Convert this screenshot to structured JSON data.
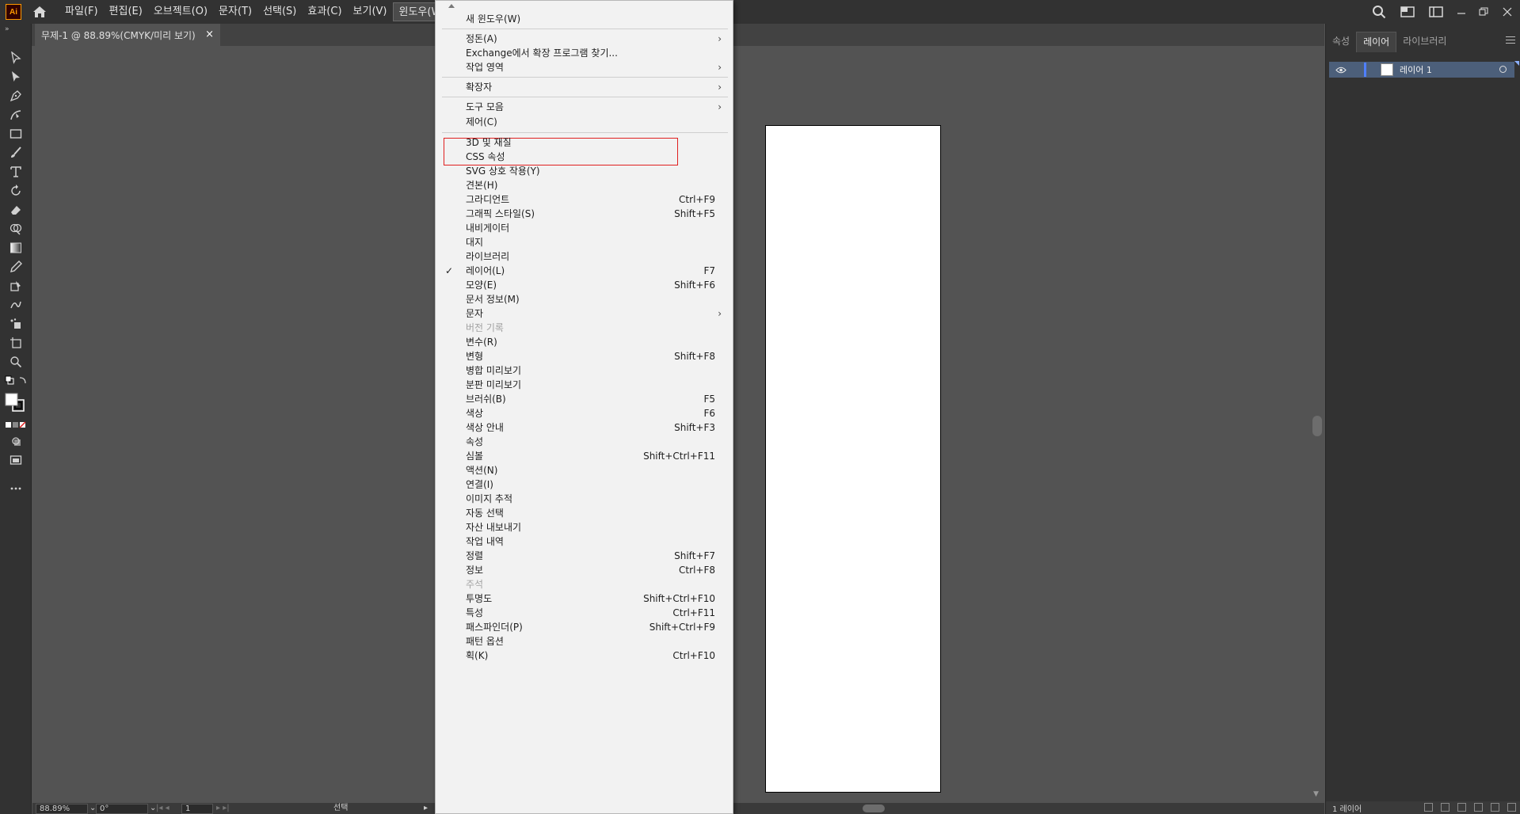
{
  "app": {
    "logo_text": "Ai"
  },
  "menubar": {
    "items": [
      "파일(F)",
      "편집(E)",
      "오브젝트(O)",
      "문자(T)",
      "선택(S)",
      "효과(C)",
      "보기(V)",
      "윈도우(W)"
    ],
    "active_index": 7
  },
  "document_tab": {
    "title": "무제-1 @ 88.89%(CMYK/미리 보기)",
    "close": "×"
  },
  "status": {
    "zoom": "88.89%",
    "rotation": "0°",
    "artboard": "1",
    "tool": "선택"
  },
  "right_panel": {
    "tabs": [
      "속성",
      "레이어",
      "라이브러리"
    ],
    "active_tab": 1,
    "layer_name": "레이어 1",
    "layer_count": "1 레이어"
  },
  "window_menu": {
    "items": [
      {
        "label": "새 윈도우(W)",
        "shortcut": "",
        "submenu": false,
        "checked": false,
        "disabled": false
      },
      {
        "sep": true
      },
      {
        "label": "정돈(A)",
        "shortcut": "",
        "submenu": true,
        "checked": false,
        "disabled": false
      },
      {
        "label": "Exchange에서 확장 프로그램 찾기...",
        "shortcut": "",
        "submenu": false,
        "checked": false,
        "disabled": false
      },
      {
        "label": "작업 영역",
        "shortcut": "",
        "submenu": true,
        "checked": false,
        "disabled": false
      },
      {
        "sep": true
      },
      {
        "label": "확장자",
        "shortcut": "",
        "submenu": true,
        "checked": false,
        "disabled": false
      },
      {
        "sep": true
      },
      {
        "label": "도구 모음",
        "shortcut": "",
        "submenu": true,
        "checked": false,
        "disabled": false
      },
      {
        "label": "제어(C)",
        "shortcut": "",
        "submenu": false,
        "checked": false,
        "disabled": false
      },
      {
        "sep": true
      },
      {
        "label": "3D 및 재질",
        "shortcut": "",
        "submenu": false,
        "checked": false,
        "disabled": false
      },
      {
        "label": "CSS 속성",
        "shortcut": "",
        "submenu": false,
        "checked": false,
        "disabled": false
      },
      {
        "label": "SVG 상호 작용(Y)",
        "shortcut": "",
        "submenu": false,
        "checked": false,
        "disabled": false
      },
      {
        "label": "견본(H)",
        "shortcut": "",
        "submenu": false,
        "checked": false,
        "disabled": false
      },
      {
        "label": "그라디언트",
        "shortcut": "Ctrl+F9",
        "submenu": false,
        "checked": false,
        "disabled": false
      },
      {
        "label": "그래픽 스타일(S)",
        "shortcut": "Shift+F5",
        "submenu": false,
        "checked": false,
        "disabled": false
      },
      {
        "label": "내비게이터",
        "shortcut": "",
        "submenu": false,
        "checked": false,
        "disabled": false
      },
      {
        "label": "대지",
        "shortcut": "",
        "submenu": false,
        "checked": false,
        "disabled": false
      },
      {
        "label": "라이브러리",
        "shortcut": "",
        "submenu": false,
        "checked": false,
        "disabled": false
      },
      {
        "label": "레이어(L)",
        "shortcut": "F7",
        "submenu": false,
        "checked": true,
        "disabled": false
      },
      {
        "label": "모양(E)",
        "shortcut": "Shift+F6",
        "submenu": false,
        "checked": false,
        "disabled": false
      },
      {
        "label": "문서 정보(M)",
        "shortcut": "",
        "submenu": false,
        "checked": false,
        "disabled": false
      },
      {
        "label": "문자",
        "shortcut": "",
        "submenu": true,
        "checked": false,
        "disabled": false
      },
      {
        "label": "버전 기록",
        "shortcut": "",
        "submenu": false,
        "checked": false,
        "disabled": true
      },
      {
        "label": "변수(R)",
        "shortcut": "",
        "submenu": false,
        "checked": false,
        "disabled": false
      },
      {
        "label": "변형",
        "shortcut": "Shift+F8",
        "submenu": false,
        "checked": false,
        "disabled": false
      },
      {
        "label": "병합 미리보기",
        "shortcut": "",
        "submenu": false,
        "checked": false,
        "disabled": false
      },
      {
        "label": "분판 미리보기",
        "shortcut": "",
        "submenu": false,
        "checked": false,
        "disabled": false
      },
      {
        "label": "브러쉬(B)",
        "shortcut": "F5",
        "submenu": false,
        "checked": false,
        "disabled": false
      },
      {
        "label": "색상",
        "shortcut": "F6",
        "submenu": false,
        "checked": false,
        "disabled": false
      },
      {
        "label": "색상 안내",
        "shortcut": "Shift+F3",
        "submenu": false,
        "checked": false,
        "disabled": false
      },
      {
        "label": "속성",
        "shortcut": "",
        "submenu": false,
        "checked": false,
        "disabled": false
      },
      {
        "label": "심볼",
        "shortcut": "Shift+Ctrl+F11",
        "submenu": false,
        "checked": false,
        "disabled": false
      },
      {
        "label": "액션(N)",
        "shortcut": "",
        "submenu": false,
        "checked": false,
        "disabled": false
      },
      {
        "label": "연결(I)",
        "shortcut": "",
        "submenu": false,
        "checked": false,
        "disabled": false
      },
      {
        "label": "이미지 추적",
        "shortcut": "",
        "submenu": false,
        "checked": false,
        "disabled": false
      },
      {
        "label": "자동 선택",
        "shortcut": "",
        "submenu": false,
        "checked": false,
        "disabled": false
      },
      {
        "label": "자산 내보내기",
        "shortcut": "",
        "submenu": false,
        "checked": false,
        "disabled": false
      },
      {
        "label": "작업 내역",
        "shortcut": "",
        "submenu": false,
        "checked": false,
        "disabled": false
      },
      {
        "label": "정렬",
        "shortcut": "Shift+F7",
        "submenu": false,
        "checked": false,
        "disabled": false
      },
      {
        "label": "정보",
        "shortcut": "Ctrl+F8",
        "submenu": false,
        "checked": false,
        "disabled": false
      },
      {
        "label": "주석",
        "shortcut": "",
        "submenu": false,
        "checked": false,
        "disabled": true
      },
      {
        "label": "투명도",
        "shortcut": "Shift+Ctrl+F10",
        "submenu": false,
        "checked": false,
        "disabled": false
      },
      {
        "label": "특성",
        "shortcut": "Ctrl+F11",
        "submenu": false,
        "checked": false,
        "disabled": false
      },
      {
        "label": "패스파인더(P)",
        "shortcut": "Shift+Ctrl+F9",
        "submenu": false,
        "checked": false,
        "disabled": false
      },
      {
        "label": "패턴 옵션",
        "shortcut": "",
        "submenu": false,
        "checked": false,
        "disabled": false
      },
      {
        "label": "획(K)",
        "shortcut": "Ctrl+F10",
        "submenu": false,
        "checked": false,
        "disabled": false
      }
    ],
    "submenu_glyph": "›",
    "check_glyph": "✓"
  },
  "icons": {
    "toolbar": [
      "selection-icon",
      "direct-selection-icon",
      "pen-icon",
      "curvature-icon",
      "rectangle-icon",
      "paintbrush-icon",
      "type-icon",
      "rotate-icon",
      "eraser-icon",
      "shape-builder-icon",
      "gradient-icon",
      "eyedropper-icon",
      "live-paint-icon",
      "puppet-warp-icon",
      "symbol-sprayer-icon",
      "artboard-icon",
      "zoom-icon"
    ]
  },
  "colors": {
    "highlight_border": "#e02020",
    "menu_bg": "#f2f2f2",
    "app_bg": "#535353"
  }
}
